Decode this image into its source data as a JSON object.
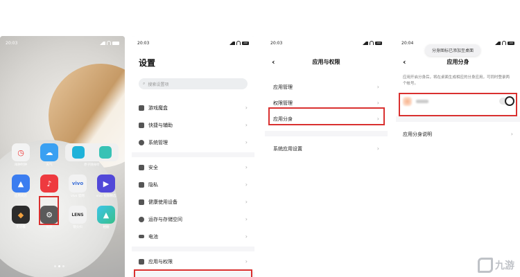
{
  "screens": {
    "home": {
      "time": "20:03",
      "battery": "100",
      "apps": [
        {
          "label": "闹钟时钟",
          "icon": "clock-icon",
          "color": "#f3f3f3"
        },
        {
          "label": "天气",
          "icon": "weather-icon",
          "color": "#3aa0f2"
        },
        {
          "label": "原子随身听",
          "icon": "music-folder-icon",
          "color": "#f0f0f0"
        },
        {
          "label": "应用商店",
          "icon": "app-store-icon",
          "color": "#3b7df0"
        },
        {
          "label": "i音乐",
          "icon": "music-icon",
          "color": "#ee3a3f"
        },
        {
          "label": "vivo 官网",
          "icon": "vivo-icon",
          "color": "#f2f2f2"
        },
        {
          "label": "vivo 视频精选",
          "icon": "video-icon",
          "color": "#5148d8"
        },
        {
          "label": "无尽模",
          "icon": "cube-icon",
          "color": "#2c2c2c"
        },
        {
          "label": "设置",
          "icon": "gear-icon",
          "color": "#5a5a5a"
        },
        {
          "label": "镜头扫",
          "icon": "lens-icon",
          "color": "#f2f2f2"
        },
        {
          "label": "相册",
          "icon": "gallery-icon",
          "color": "#38c0a6"
        }
      ]
    },
    "settings": {
      "time": "20:03",
      "battery": "100",
      "title": "设置",
      "search_placeholder": "搜索设置项",
      "group1": [
        "游戏魔盒",
        "快捷与辅助",
        "系统管理"
      ],
      "group2": [
        "安全",
        "隐私",
        "健康使用设备",
        "运存与存储空间",
        "电池"
      ],
      "group3": [
        "应用与权限"
      ]
    },
    "app_permission": {
      "time": "20:03",
      "battery": "100",
      "title": "应用与权限",
      "items": [
        "应用管理",
        "权限管理",
        "应用分身"
      ],
      "items2": [
        "系统应用设置"
      ]
    },
    "clone": {
      "time": "20:04",
      "battery": "100",
      "toast": "分身图标已添加至桌面",
      "title": "应用分身",
      "desc": "应用开启分身后，将在桌面生成相应的分身应用，可同时登录两个帐号。",
      "app_name_blurred": "QQ",
      "toggle_on": false,
      "help": "应用分身说明"
    }
  },
  "watermark": "九游",
  "highlight_color": "#d9302f"
}
